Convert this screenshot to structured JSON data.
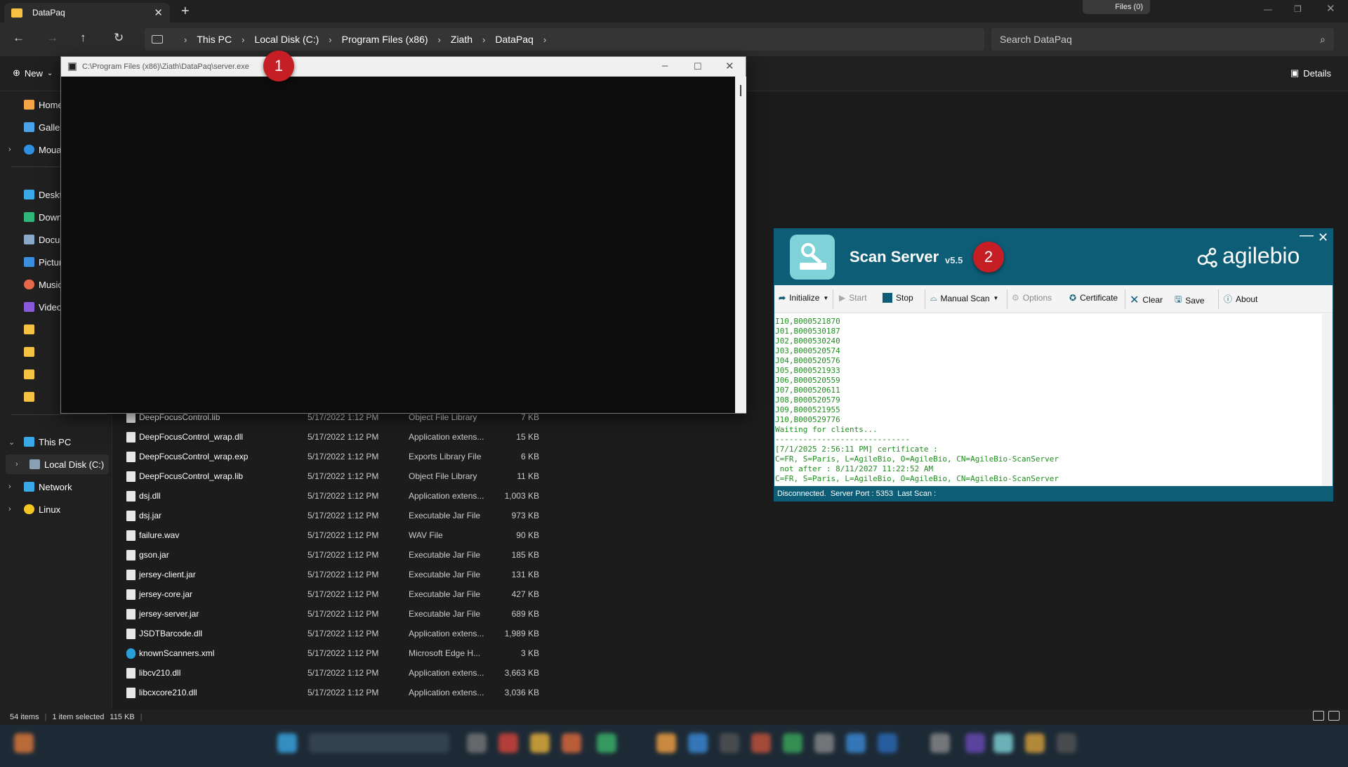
{
  "explorer": {
    "tab_title": "DataPaq",
    "files_button": "Files (0)",
    "breadcrumb": [
      "This PC",
      "Local Disk (C:)",
      "Program Files (x86)",
      "Ziath",
      "DataPaq"
    ],
    "search_placeholder": "Search DataPaq",
    "new_label": "New",
    "details_label": "Details",
    "sidebar": {
      "home": "Home",
      "gallery": "Galler",
      "onedrive": "Moua",
      "desktop": "Deskt",
      "downloads": "Down",
      "documents": "Docu",
      "pictures": "Pictur",
      "music": "Music",
      "videos": "Video",
      "this_pc": "This PC",
      "local_disk": "Local Disk (C:)",
      "network": "Network",
      "linux": "Linux"
    },
    "files": [
      {
        "name": "DeepFocusControl.lib",
        "date": "5/17/2022 1:12 PM",
        "type": "Object File Library",
        "size": "7 KB"
      },
      {
        "name": "DeepFocusControl_wrap.dll",
        "date": "5/17/2022 1:12 PM",
        "type": "Application extens...",
        "size": "15 KB"
      },
      {
        "name": "DeepFocusControl_wrap.exp",
        "date": "5/17/2022 1:12 PM",
        "type": "Exports Library File",
        "size": "6 KB"
      },
      {
        "name": "DeepFocusControl_wrap.lib",
        "date": "5/17/2022 1:12 PM",
        "type": "Object File Library",
        "size": "11 KB"
      },
      {
        "name": "dsj.dll",
        "date": "5/17/2022 1:12 PM",
        "type": "Application extens...",
        "size": "1,003 KB"
      },
      {
        "name": "dsj.jar",
        "date": "5/17/2022 1:12 PM",
        "type": "Executable Jar File",
        "size": "973 KB"
      },
      {
        "name": "failure.wav",
        "date": "5/17/2022 1:12 PM",
        "type": "WAV File",
        "size": "90 KB"
      },
      {
        "name": "gson.jar",
        "date": "5/17/2022 1:12 PM",
        "type": "Executable Jar File",
        "size": "185 KB"
      },
      {
        "name": "jersey-client.jar",
        "date": "5/17/2022 1:12 PM",
        "type": "Executable Jar File",
        "size": "131 KB"
      },
      {
        "name": "jersey-core.jar",
        "date": "5/17/2022 1:12 PM",
        "type": "Executable Jar File",
        "size": "427 KB"
      },
      {
        "name": "jersey-server.jar",
        "date": "5/17/2022 1:12 PM",
        "type": "Executable Jar File",
        "size": "689 KB"
      },
      {
        "name": "JSDTBarcode.dll",
        "date": "5/17/2022 1:12 PM",
        "type": "Application extens...",
        "size": "1,989 KB"
      },
      {
        "name": "knownScanners.xml",
        "date": "5/17/2022 1:12 PM",
        "type": "Microsoft Edge H...",
        "size": "3 KB"
      },
      {
        "name": "libcv210.dll",
        "date": "5/17/2022 1:12 PM",
        "type": "Application extens...",
        "size": "3,663 KB"
      },
      {
        "name": "libcxcore210.dll",
        "date": "5/17/2022 1:12 PM",
        "type": "Application extens...",
        "size": "3,036 KB"
      }
    ],
    "status": {
      "items": "54 items",
      "selected": "1 item selected",
      "size": "115 KB"
    }
  },
  "console": {
    "title": "C:\\Program Files (x86)\\Ziath\\DataPaq\\server.exe"
  },
  "badges": {
    "one": "1",
    "two": "2"
  },
  "scan_server": {
    "title": "Scan Server",
    "version": "v5.5",
    "brand": "agilebio",
    "toolbar": {
      "initialize": "Initialize",
      "start": "Start",
      "stop": "Stop",
      "manual_scan": "Manual Scan",
      "options": "Options",
      "certificate": "Certificate",
      "clear": "Clear",
      "save": "Save",
      "about": "About"
    },
    "log": [
      "I10,B000521870",
      "J01,B000530187",
      "J02,B000530240",
      "J03,B000520574",
      "J04,B000520576",
      "J05,B000521933",
      "J06,B000520559",
      "J07,B000520611",
      "J08,B000520579",
      "J09,B000521955",
      "J10,B000529776",
      "Waiting for clients...",
      "-----------------------------",
      "[7/1/2025 2:56:11 PM] certificate :",
      "C=FR, S=Paris, L=AgileBio, O=AgileBio, CN=AgileBio-ScanServer",
      " not after : 8/11/2027 11:22:52 AM",
      "C=FR, S=Paris, L=AgileBio, O=AgileBio, CN=AgileBio-ScanServer"
    ],
    "status_line": "Disconnected.  Server Port : 5353  Last Scan :"
  }
}
